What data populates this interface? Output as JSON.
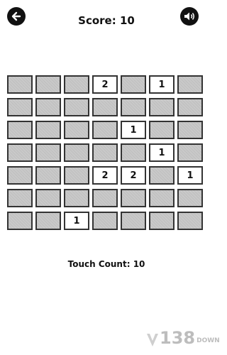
{
  "header": {
    "score_label": "Score:",
    "score_value": "10",
    "back_icon": "arrow-left-icon",
    "sound_icon": "speaker-icon"
  },
  "board": {
    "rows": [
      [
        "",
        "",
        "",
        "2",
        "",
        "1",
        ""
      ],
      [
        "",
        "",
        "",
        "",
        "",
        "",
        ""
      ],
      [
        "",
        "",
        "",
        "",
        "1",
        "",
        ""
      ],
      [
        "",
        "",
        "",
        "",
        "",
        "1",
        ""
      ],
      [
        "",
        "",
        "",
        "2",
        "2",
        "",
        "1"
      ],
      [
        "",
        "",
        "",
        "",
        "",
        "",
        ""
      ],
      [
        "",
        "",
        "1",
        "",
        "",
        "",
        ""
      ]
    ]
  },
  "footer": {
    "touch_label": "Touch Count:",
    "touch_value": "10"
  },
  "watermark": {
    "number": "138",
    "suffix": "DOWN"
  }
}
